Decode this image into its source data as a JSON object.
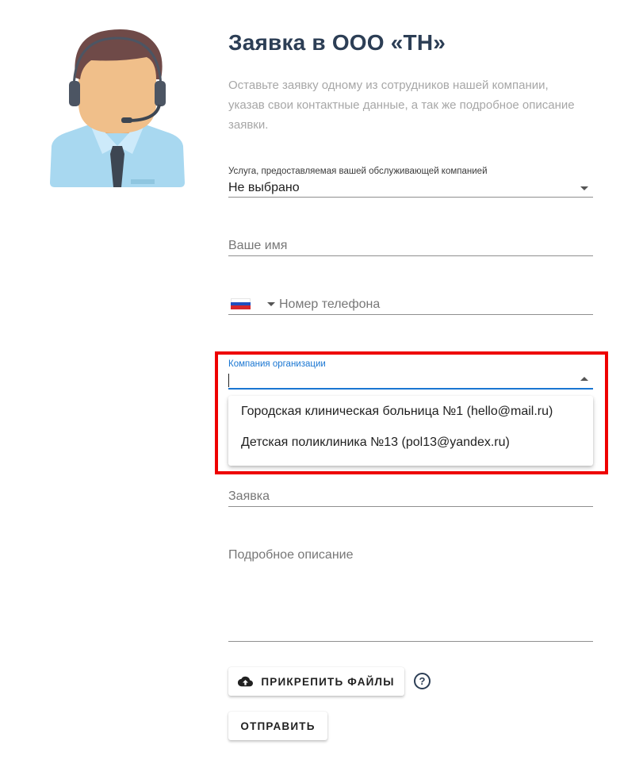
{
  "header": {
    "title": "Заявка в ООО «ТН»",
    "description": "Оставьте заявку одному из сотрудников нашей компании, указав свои контактные данные, а так же подробное описание заявки."
  },
  "form": {
    "service": {
      "label": "Услуга, предоставляемая вашей обслуживающей компанией",
      "value": "Не выбрано"
    },
    "name": {
      "placeholder": "Ваше имя"
    },
    "phone": {
      "placeholder": "Номер телефона",
      "country": "RU"
    },
    "company": {
      "label": "Компания организации",
      "value": "",
      "options": [
        "Городская клиническая больница №1 (hello@mail.ru)",
        "Детская поликлиника №13 (pol13@yandex.ru)"
      ]
    },
    "request": {
      "placeholder": "Заявка"
    },
    "details": {
      "placeholder": "Подробное описание"
    }
  },
  "buttons": {
    "attach": "ПРИКРЕПИТЬ ФАЙЛЫ",
    "help": "?",
    "submit": "ОТПРАВИТЬ"
  },
  "icons": {
    "attach": "cloud-upload-icon",
    "help": "help-circle-icon"
  },
  "colors": {
    "title": "#2c3e55",
    "focus": "#1976d2",
    "highlight": "#ee0000"
  }
}
